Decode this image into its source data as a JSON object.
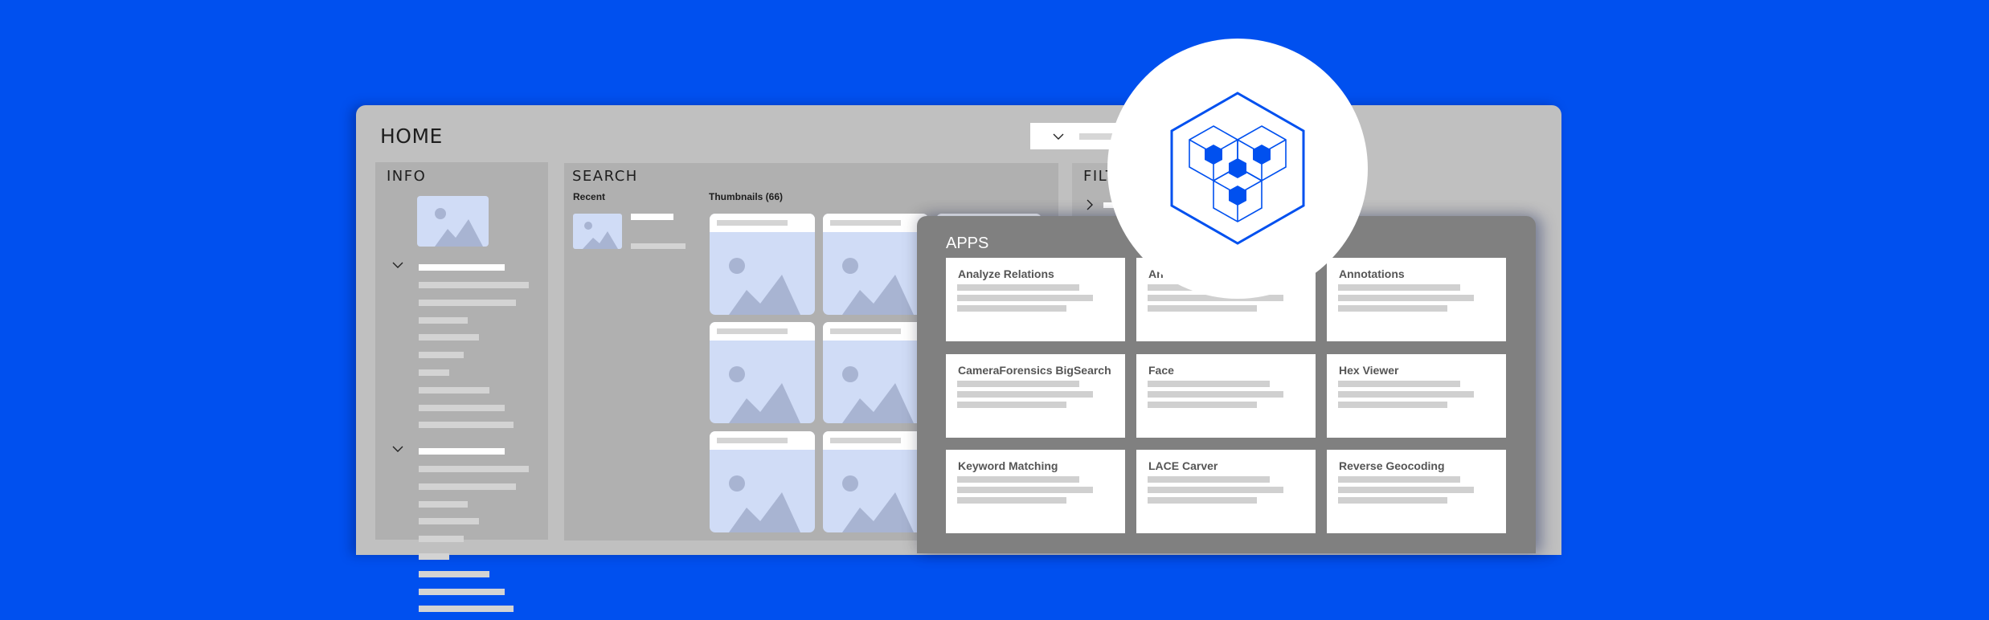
{
  "colors": {
    "background": "#0050EF",
    "window": "#C0C0C0",
    "panel": "#B0B0B0",
    "apps_panel": "#808080",
    "accent": "#0050EF",
    "placeholder_image": "#D0DCF6",
    "placeholder_shape": "#A8B4D2"
  },
  "window": {
    "title": "HOME"
  },
  "header": {
    "dropdown": {
      "icon": "chevron-down-icon"
    }
  },
  "info": {
    "title": "INFO",
    "groups": [
      {
        "expanded": true,
        "item_count": 9
      },
      {
        "expanded": true,
        "item_count": 5
      }
    ]
  },
  "search": {
    "title": "SEARCH",
    "recent_label": "Recent",
    "thumbnails_label": "Thumbnails (66)"
  },
  "filter": {
    "title": "FILTER",
    "visible_title": "FILT",
    "item_icon": "chevron-right-icon"
  },
  "apps": {
    "title": "APPS",
    "items": [
      {
        "label": "Analyze Relations"
      },
      {
        "label": "An"
      },
      {
        "label": "Annotations"
      },
      {
        "label": "CameraForensics BigSearch"
      },
      {
        "label": "Face"
      },
      {
        "label": "Hex Viewer"
      },
      {
        "label": "Keyword Matching"
      },
      {
        "label": "LACE Carver"
      },
      {
        "label": "Reverse Geocoding"
      }
    ]
  },
  "logo": {
    "icon": "hexagon-cubes-logo-icon"
  }
}
